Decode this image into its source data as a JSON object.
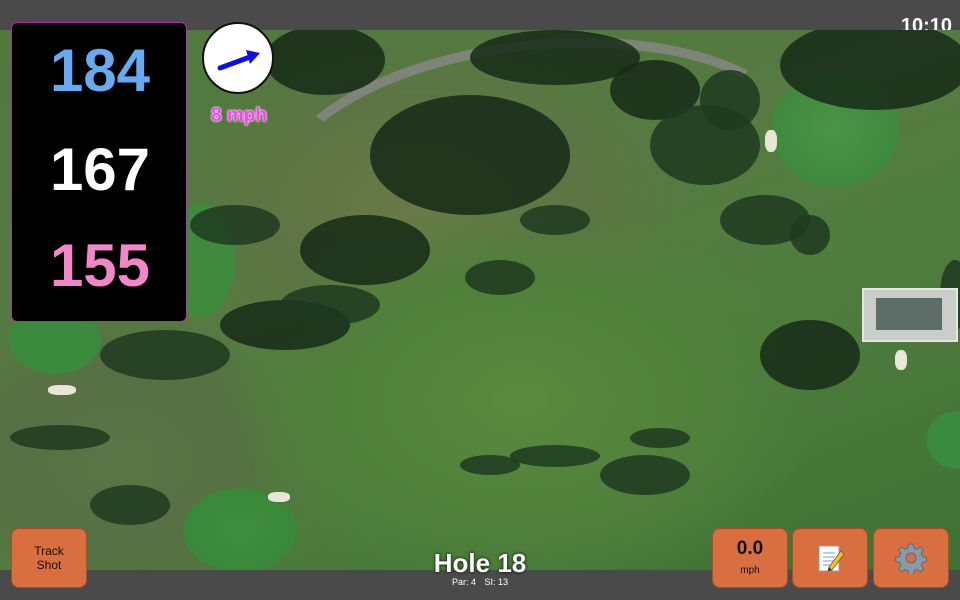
{
  "status": {
    "time": "10:10"
  },
  "distances": {
    "back": "184",
    "middle": "167",
    "front": "155"
  },
  "wind": {
    "speed": "8 mph",
    "direction_icon": "arrow-icon"
  },
  "hole": {
    "title": "Hole 18",
    "par": "Par: 4",
    "si": "SI: 13"
  },
  "buttons": {
    "track_shot_line1": "Track",
    "track_shot_line2": "Shot",
    "speed_value": "0.0",
    "speed_unit": "mph",
    "notes_icon": "notepad-icon",
    "settings_icon": "gear-icon"
  },
  "colors": {
    "back_distance": "#69a9f0",
    "middle_distance": "#ffffff",
    "front_distance": "#f088c8",
    "wind_text": "#ff3bff",
    "button_orange": "#d96e40"
  }
}
